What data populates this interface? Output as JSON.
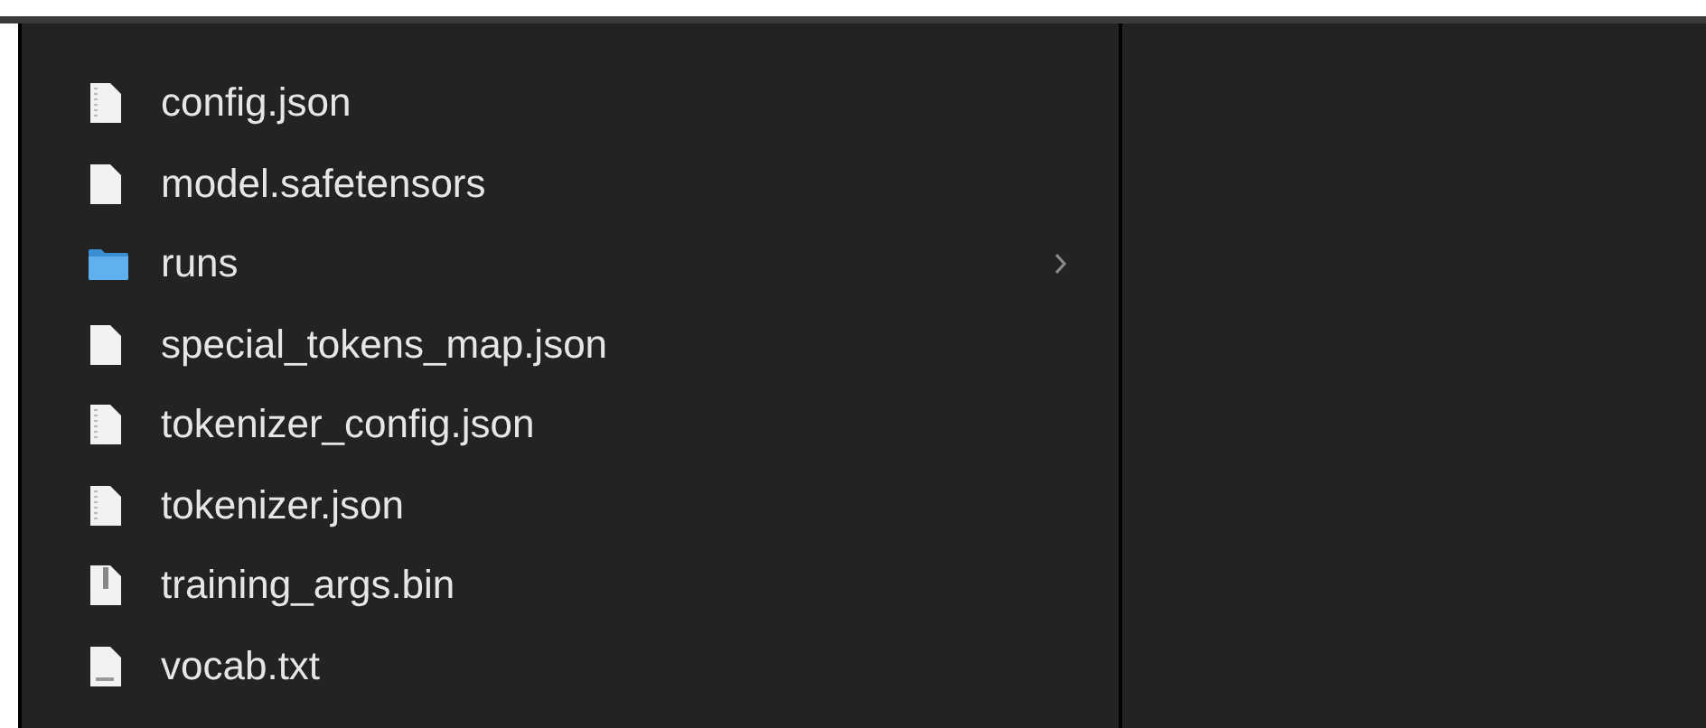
{
  "files": [
    {
      "name": "config.json",
      "kind": "text"
    },
    {
      "name": "model.safetensors",
      "kind": "document"
    },
    {
      "name": "runs",
      "kind": "folder"
    },
    {
      "name": "special_tokens_map.json",
      "kind": "document"
    },
    {
      "name": "tokenizer_config.json",
      "kind": "text"
    },
    {
      "name": "tokenizer.json",
      "kind": "text"
    },
    {
      "name": "training_args.bin",
      "kind": "binary"
    },
    {
      "name": "vocab.txt",
      "kind": "plaintext"
    }
  ]
}
